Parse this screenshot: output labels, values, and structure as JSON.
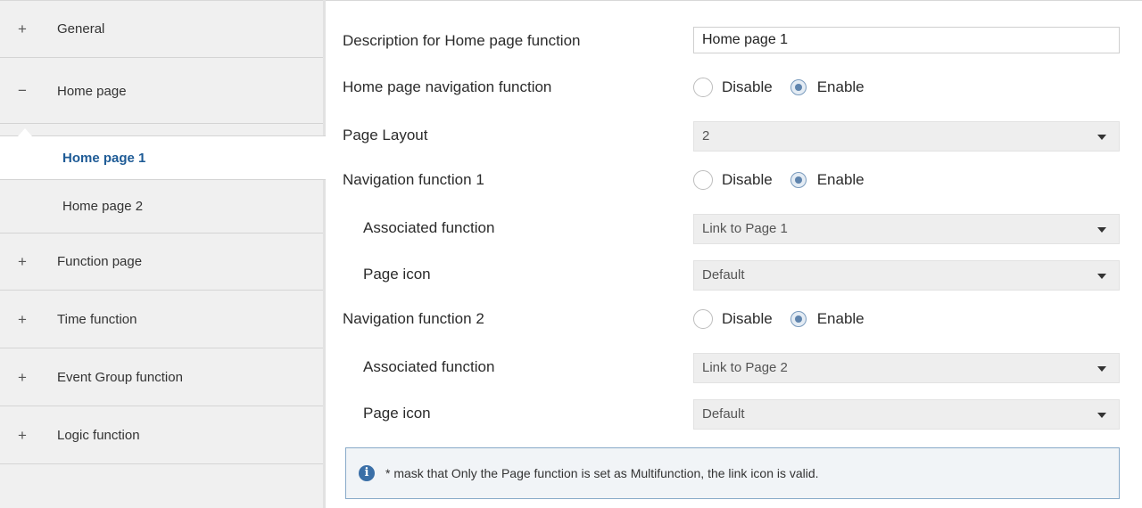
{
  "sidebar": {
    "items": [
      {
        "sign": "+",
        "label": "General"
      },
      {
        "sign": "−",
        "label": "Home page"
      },
      {
        "label": "Home page 1"
      },
      {
        "label": "Home page 2"
      },
      {
        "sign": "+",
        "label": "Function page"
      },
      {
        "sign": "+",
        "label": "Time function"
      },
      {
        "sign": "+",
        "label": "Event Group function"
      },
      {
        "sign": "+",
        "label": "Logic function"
      }
    ]
  },
  "main": {
    "description": {
      "label": "Description for Home page function",
      "value": "Home page 1"
    },
    "navigation": {
      "label": "Home page navigation function",
      "options": [
        "Disable",
        "Enable"
      ],
      "selected": "Enable"
    },
    "layout": {
      "label": "Page Layout",
      "value": "2"
    },
    "nav1": {
      "label": "Navigation function 1",
      "options": [
        "Disable",
        "Enable"
      ],
      "selected": "Enable"
    },
    "assoc1": {
      "label": "Associated function",
      "value": "Link to Page 1"
    },
    "icon1": {
      "label": "Page icon",
      "value": "Default"
    },
    "nav2": {
      "label": "Navigation function 2",
      "options": [
        "Disable",
        "Enable"
      ],
      "selected": "Enable"
    },
    "assoc2": {
      "label": "Associated function",
      "value": "Link to Page 2"
    },
    "icon2": {
      "label": "Page icon",
      "value": "Default"
    },
    "info": {
      "icon": "info-icon",
      "text": "* mask that Only the Page function is set as Multifunction, the link icon  is valid."
    }
  },
  "colors": {
    "active_text": "#1e5b96",
    "info_border": "#87a9c8",
    "info_icon": "#3a6fa7"
  }
}
